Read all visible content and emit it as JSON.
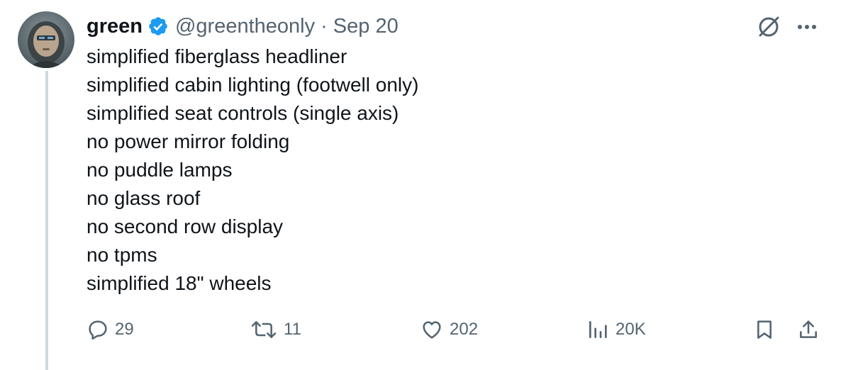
{
  "author": {
    "display_name": "green",
    "handle": "@greentheonly",
    "separator": "·",
    "date": "Sep 20",
    "verified": true
  },
  "tweet": {
    "lines": [
      "simplified fiberglass headliner",
      "simplified cabin lighting (footwell only)",
      "simplified seat controls (single axis)",
      "no power mirror folding",
      "no puddle lamps",
      "no glass roof",
      "no second row display",
      "no tpms",
      "simplified 18\" wheels"
    ]
  },
  "actions": {
    "replies": {
      "icon": "reply-icon",
      "count": "29"
    },
    "reposts": {
      "icon": "repost-icon",
      "count": "11"
    },
    "likes": {
      "icon": "heart-icon",
      "count": "202"
    },
    "views": {
      "icon": "views-icon",
      "count": "20K"
    },
    "bookmark": {
      "icon": "bookmark-icon"
    },
    "share": {
      "icon": "share-icon"
    }
  },
  "colors": {
    "text": "#0f1419",
    "secondary": "#536471",
    "verified": "#1d9bf0",
    "thread_line": "#cfd9de"
  }
}
